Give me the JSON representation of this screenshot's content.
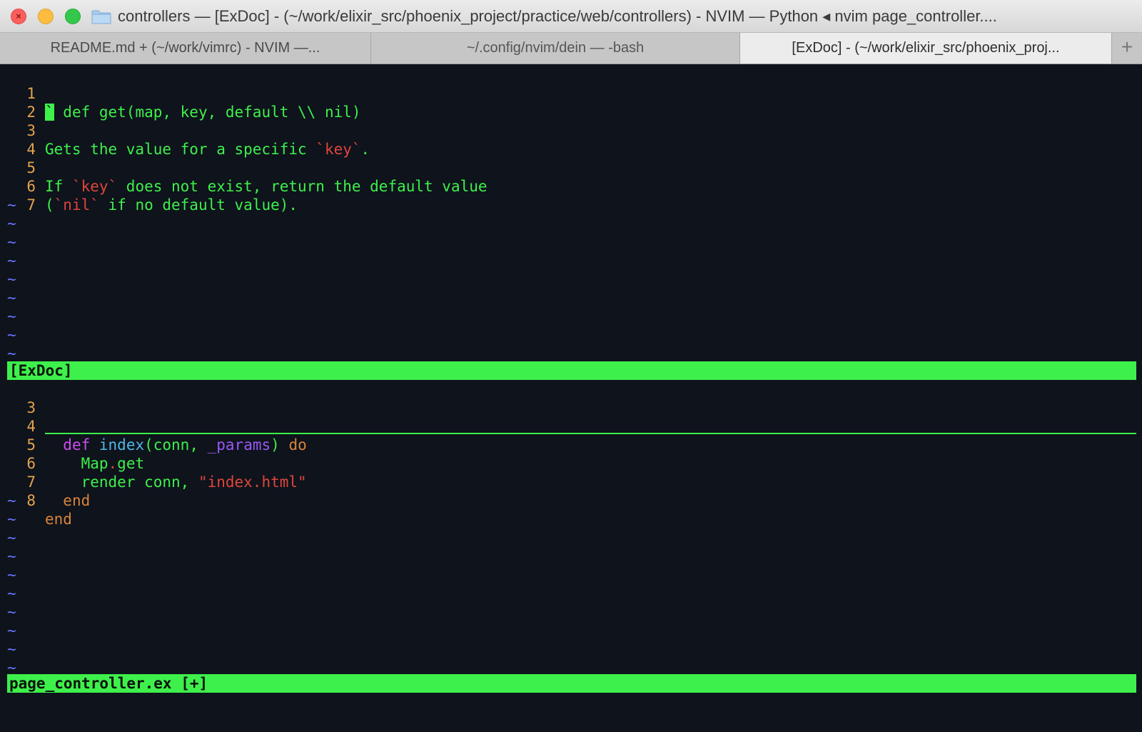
{
  "window": {
    "title": "controllers — [ExDoc] - (~/work/elixir_src/phoenix_project/practice/web/controllers) - NVIM — Python ◂ nvim page_controller....",
    "close_glyph": "×"
  },
  "tabs": [
    {
      "label": "README.md + (~/work/vimrc) - NVIM —..."
    },
    {
      "label": "~/.config/nvim/dein — -bash"
    },
    {
      "label": "[ExDoc] - (~/work/elixir_src/phoenix_proj..."
    }
  ],
  "new_tab_label": "+",
  "doc_pane": {
    "lines": [
      {
        "n": "1",
        "cursor": "`",
        "parts": [
          " def get(map, key, default \\\\ nil)"
        ]
      },
      {
        "n": "2"
      },
      {
        "n": "3",
        "parts": [
          "Gets the value for a specific ",
          "`key`",
          "."
        ]
      },
      {
        "n": "4"
      },
      {
        "n": "5",
        "parts": [
          "If ",
          "`key`",
          " does not exist, return the default value"
        ]
      },
      {
        "n": "6",
        "parts": [
          "(",
          "`nil`",
          " if no default value)."
        ]
      },
      {
        "n": "7"
      }
    ],
    "tilde": "~",
    "status": "[ExDoc]"
  },
  "code_pane": {
    "lines": [
      {
        "n": "3"
      },
      {
        "n": "4",
        "parts": [
          "  ",
          "def",
          " ",
          "index",
          "(conn, ",
          "_params",
          ") ",
          "do"
        ]
      },
      {
        "n": "5",
        "parts": [
          "    ",
          "Map",
          ".",
          "get"
        ]
      },
      {
        "n": "6",
        "parts": [
          "    render conn, ",
          "\"index.html\""
        ]
      },
      {
        "n": "7",
        "parts": [
          "  ",
          "end"
        ]
      },
      {
        "n": "8",
        "parts": [
          "end"
        ]
      }
    ],
    "status": "page_controller.ex [+]"
  },
  "colors": {
    "background": "#0e131c",
    "green": "#3ef04b",
    "red": "#e0453b",
    "orange": "#d8843a",
    "magenta": "#ce4df0",
    "cyan": "#4fb7e6",
    "purple": "#9a57f5",
    "tilde": "#6b74ff",
    "line_number": "#e5a34d"
  }
}
